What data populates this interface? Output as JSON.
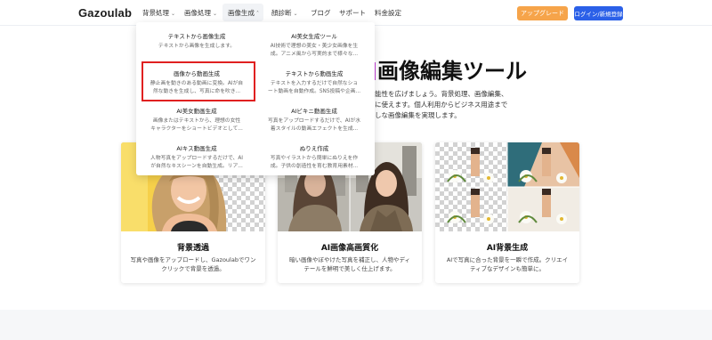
{
  "header": {
    "logo": "Gazoulab",
    "nav": [
      {
        "label": "背景処理",
        "chevron": "⌄"
      },
      {
        "label": "画像処理",
        "chevron": "⌄"
      },
      {
        "label": "画像生成",
        "chevron": "˄"
      },
      {
        "label": "顔診断",
        "chevron": "⌄"
      },
      {
        "label": "ブログ",
        "chevron": ""
      },
      {
        "label": "サポート",
        "chevron": ""
      },
      {
        "label": "料金設定",
        "chevron": ""
      }
    ],
    "upgrade_label": "アップグレード",
    "login_label": "ログイン/新規登録"
  },
  "dropdown": {
    "items": [
      {
        "title": "テキストから画像生成",
        "desc": [
          "テキストから画像を生成します。"
        ]
      },
      {
        "title": "AI美女生成ツール",
        "desc": [
          "AI技術で理想の美女・美少女画像を生",
          "成。アニメ風から写実的まで様々な..."
        ]
      },
      {
        "title": "画像から動画生成",
        "desc": [
          "静止画を動きのある動画に変換。AIが自",
          "然な動きを生成し、写真に命を吹き..."
        ]
      },
      {
        "title": "テキストから動画生成",
        "desc": [
          "テキストを入力するだけで自然なショ",
          "ート動画を自動作成。SNS投稿や企画..."
        ]
      },
      {
        "title": "AI美女動画生成",
        "desc": [
          "画像またはテキストから、理想の女性",
          "キャラクターをショートビデオとして..."
        ]
      },
      {
        "title": "AIビキニ動画生成",
        "desc": [
          "写真をアップロードするだけで、AIが水",
          "着スタイルの動画エフェクトを生成..."
        ]
      },
      {
        "title": "AIキス動画生成",
        "desc": [
          "人物写真をアップロードするだけで、AI",
          "が自然なキスシーンを自動生成。リア..."
        ]
      },
      {
        "title": "ぬりえ作成",
        "desc": [
          "写真やイラストから簡単にぬりえを作",
          "成。子供の創造性を育む教育用素材..."
        ]
      }
    ]
  },
  "hero": {
    "title": "画像編集ツール",
    "desc": [
      "能性を広げましょう。背景処理、画像編集、",
      "に使えます。個人利用からビジネス用途まで",
      "しな画像編集を実現します。"
    ]
  },
  "cards": [
    {
      "title": "背景透過",
      "desc": "写真や画像をアップロードし、Gazoulabでワンクリックで背景を透過。"
    },
    {
      "title": "AI画像高画質化",
      "desc": "暗い画像やぼやけた写真を補正し、人物やディテールを鮮明で美しく仕上げます。"
    },
    {
      "title": "AI背景生成",
      "desc": "AIで写真に合った背景を一瞬で作成。クリエイティブなデザインも簡単に。"
    }
  ],
  "colors": {
    "upgrade": "#f6a44a",
    "login": "#2b60e8",
    "highlight": "#e02020",
    "accent_bar": "#c640d8"
  }
}
